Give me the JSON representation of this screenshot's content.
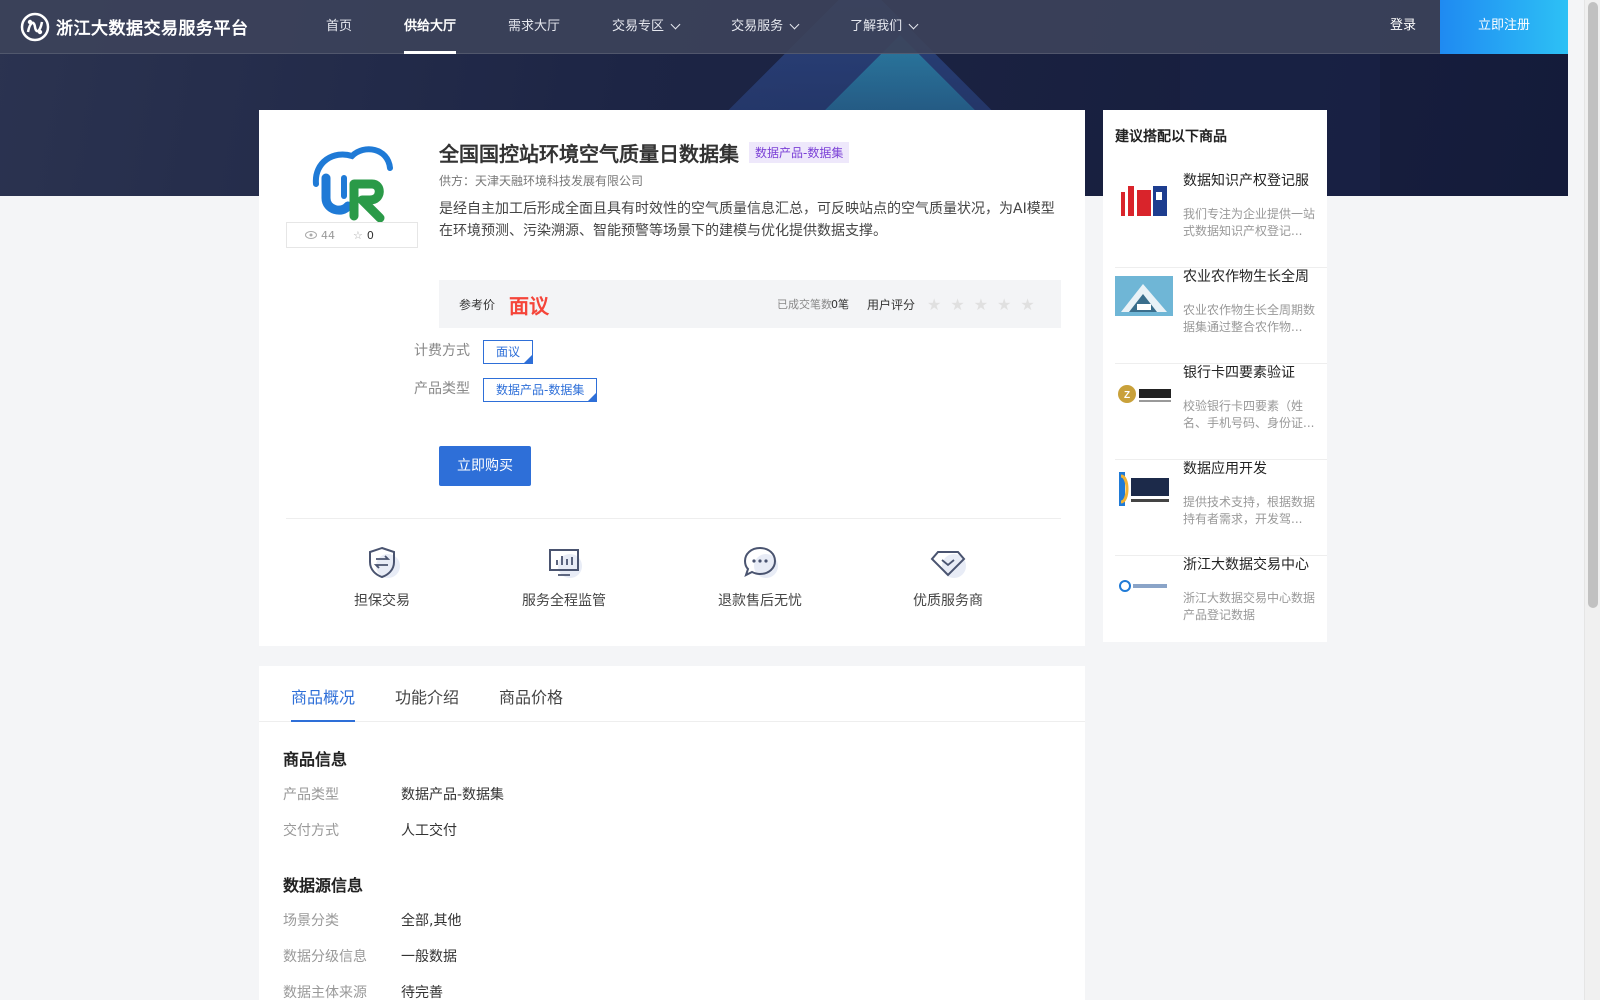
{
  "header": {
    "logo_text": "浙江大数据交易服务平台",
    "nav": [
      {
        "label": "首页",
        "active": false,
        "dropdown": false
      },
      {
        "label": "供给大厅",
        "active": true,
        "dropdown": false
      },
      {
        "label": "需求大厅",
        "active": false,
        "dropdown": false
      },
      {
        "label": "交易专区",
        "active": false,
        "dropdown": true
      },
      {
        "label": "交易服务",
        "active": false,
        "dropdown": true
      },
      {
        "label": "了解我们",
        "active": false,
        "dropdown": true
      }
    ],
    "login": "登录",
    "register": "立即注册"
  },
  "product": {
    "views": "44",
    "favorites": "0",
    "title": "全国国控站环境空气质量日数据集",
    "category_tag": "数据产品-数据集",
    "supplier": "供方：天津天融环境科技发展有限公司",
    "description": "是经自主加工后形成全面且具有时效性的空气质量信息汇总，可反映站点的空气质量状况，为AI模型在环境预测、污染溯源、智能预警等场景下的建模与优化提供数据支撑。",
    "price_label": "参考价",
    "price_value": "面议",
    "deal_label": "已成交笔数",
    "deal_value": "0笔",
    "rating_label": "用户评分",
    "rating": 0,
    "billing_label": "计费方式",
    "billing_value": "面议",
    "type_label": "产品类型",
    "type_value": "数据产品-数据集",
    "buy_button": "立即购买"
  },
  "guarantees": [
    {
      "label": "担保交易",
      "icon": "shield-exchange-icon"
    },
    {
      "label": "服务全程监管",
      "icon": "monitor-chart-icon"
    },
    {
      "label": "退款售后无忧",
      "icon": "chat-bubble-icon"
    },
    {
      "label": "优质服务商",
      "icon": "diamond-icon"
    }
  ],
  "recommend": {
    "title": "建议搭配以下商品",
    "items": [
      {
        "name": "数据知识产权登记服",
        "desc": "我们专注为企业提供一站式数据知识产权登记...",
        "thumb": "ipr-logo"
      },
      {
        "name": "农业农作物生长全周",
        "desc": "农业农作物生长全周期数据集通过整合农作物...",
        "thumb": "crop-logo"
      },
      {
        "name": "银行卡四要素验证",
        "desc": "校验银行卡四要素（姓名、手机号码、身份证...",
        "thumb": "zhongjin-logo"
      },
      {
        "name": "数据应用开发",
        "desc": "提供技术支持，根据数据持有者需求，开发驾...",
        "thumb": "dongyang-logo"
      },
      {
        "name": "浙江大数据交易中心",
        "desc": "浙江大数据交易中心数据产品登记数据",
        "thumb": "zjbdx-logo"
      }
    ]
  },
  "tabs": [
    "商品概况",
    "功能介绍",
    "商品价格"
  ],
  "details": {
    "goods_info_title": "商品信息",
    "goods_info": [
      {
        "key": "产品类型",
        "value": "数据产品-数据集"
      },
      {
        "key": "交付方式",
        "value": "人工交付"
      }
    ],
    "source_title": "数据源信息",
    "source_info": [
      {
        "key": "场景分类",
        "value": "全部,其他"
      },
      {
        "key": "数据分级信息",
        "value": "一般数据"
      },
      {
        "key": "数据主体来源",
        "value": "待完善"
      }
    ]
  },
  "colors": {
    "primary": "#2e6fd8",
    "price": "#f5453a",
    "tag_bg": "#eee8fb",
    "tag_text": "#7a3fd6"
  }
}
